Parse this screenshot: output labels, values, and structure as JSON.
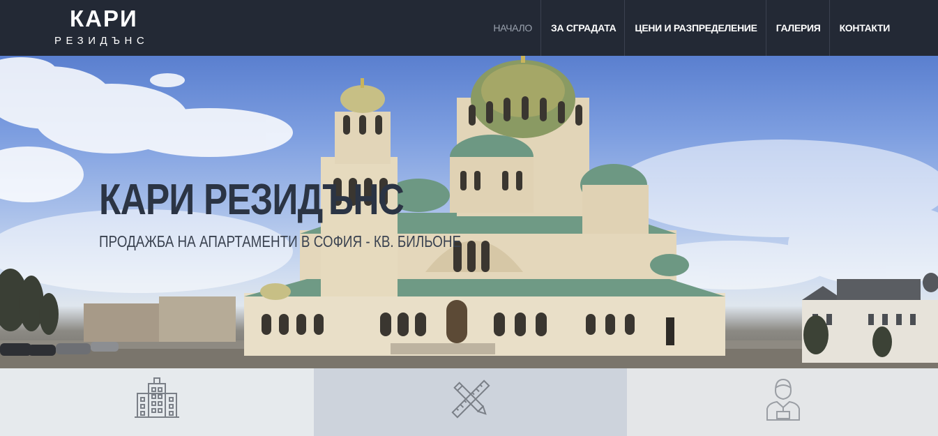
{
  "logo": {
    "main": "КАРИ",
    "sub": "РЕЗИДЪНС"
  },
  "nav": {
    "items": [
      {
        "label": "НАЧАЛО",
        "active": true
      },
      {
        "label": "ЗА СГРАДАТА",
        "active": false
      },
      {
        "label": "ЦЕНИ И РАЗПРЕДЕЛЕНИЕ",
        "active": false
      },
      {
        "label": "ГАЛЕРИЯ",
        "active": false
      },
      {
        "label": "КОНТАКТИ",
        "active": false
      }
    ]
  },
  "hero": {
    "title": "КАРИ РЕЗИДЪНС",
    "subtitle": "ПРОДАЖБА НА АПАРТАМЕНТИ В СОФИЯ - КВ. БИЛЬОНЕ"
  },
  "features": [
    {
      "icon": "building-icon"
    },
    {
      "icon": "pencil-ruler-icon"
    },
    {
      "icon": "architect-person-icon"
    }
  ],
  "colors": {
    "header_bg": "#232935",
    "nav_active": "#9aa2ae",
    "hero_title": "#2b3444",
    "feature_1_bg": "#e6eaed",
    "feature_2_bg": "#cdd3dc",
    "feature_3_bg": "#e4e6e8",
    "icon_stroke": "#7a7f87"
  }
}
